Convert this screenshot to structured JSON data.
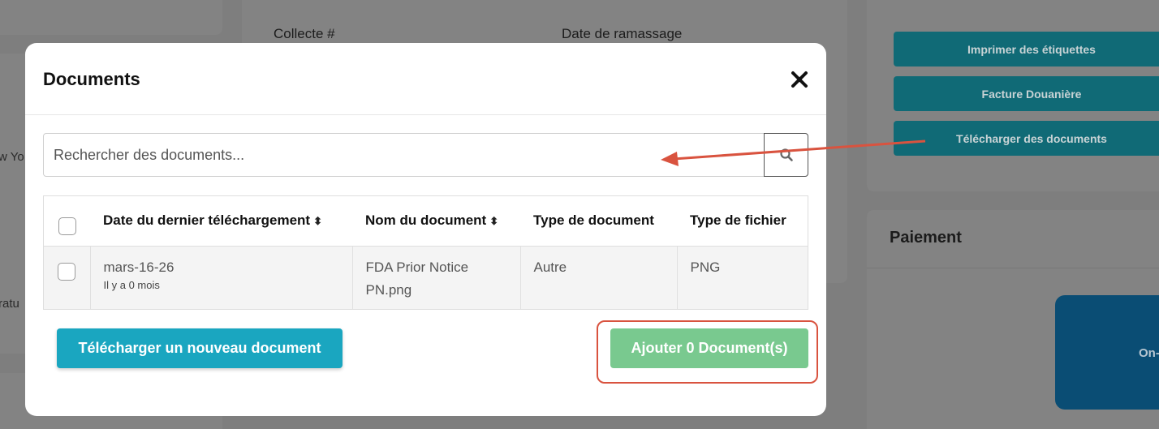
{
  "background": {
    "collecte_label": "Collecte #",
    "date_ramassage_label": "Date de ramassage",
    "left_partial_1": "w Yo",
    "left_partial_2": "ratu",
    "buttons": {
      "print_labels": "Imprimer des étiquettes",
      "customs_invoice": "Facture Douanière",
      "download_docs": "Télécharger des documents"
    },
    "payment_title": "Paiement",
    "payment_card_partial": "On-"
  },
  "modal": {
    "title": "Documents",
    "close_glyph": "✕",
    "search": {
      "placeholder": "Rechercher des documents...",
      "value": ""
    },
    "table": {
      "headers": {
        "date": "Date du dernier téléchargement",
        "name": "Nom du document",
        "doc_type": "Type de document",
        "file_type": "Type de fichier",
        "sort_glyph": "⬍"
      },
      "rows": [
        {
          "date": "mars-16-26",
          "relative": "Il y a 0 mois",
          "name": "FDA Prior Notice PN.png",
          "doc_type": "Autre",
          "file_type": "PNG"
        }
      ]
    },
    "upload_button": "Télécharger un nouveau document",
    "add_button": "Ajouter 0 Document(s)"
  },
  "colors": {
    "accent_teal": "#1aa6c0",
    "add_green": "#79c98f",
    "annotation_red": "#d9533f"
  }
}
